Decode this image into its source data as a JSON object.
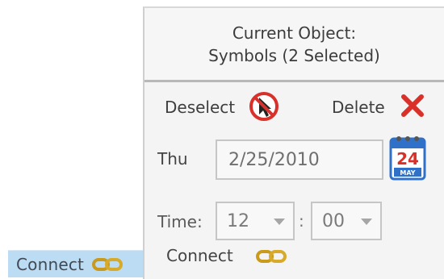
{
  "toolbar": {
    "connect_label": "Connect",
    "connect_icon": "chain-link-icon"
  },
  "panel": {
    "header_line1": "Current Object:",
    "header_line2": "Symbols (2 Selected)",
    "deselect_label": "Deselect",
    "deselect_icon": "deselect-cursor-icon",
    "delete_label": "Delete",
    "delete_icon": "red-x-icon",
    "day_label": "Thu",
    "date_value": "2/25/2010",
    "calendar_icon": {
      "name": "calendar-icon",
      "day": "24",
      "month": "MAY"
    },
    "time_label": "Time:",
    "hour_value": "12",
    "time_separator": ":",
    "minute_value": "00",
    "connect_label": "Connect",
    "connect_icon": "chain-link-icon"
  },
  "colors": {
    "toolbar_highlight": "#bcdcf3",
    "panel_bg": "#f4f4f4",
    "delete_red": "#d9302a",
    "chain_gold": "#c99a1c"
  }
}
